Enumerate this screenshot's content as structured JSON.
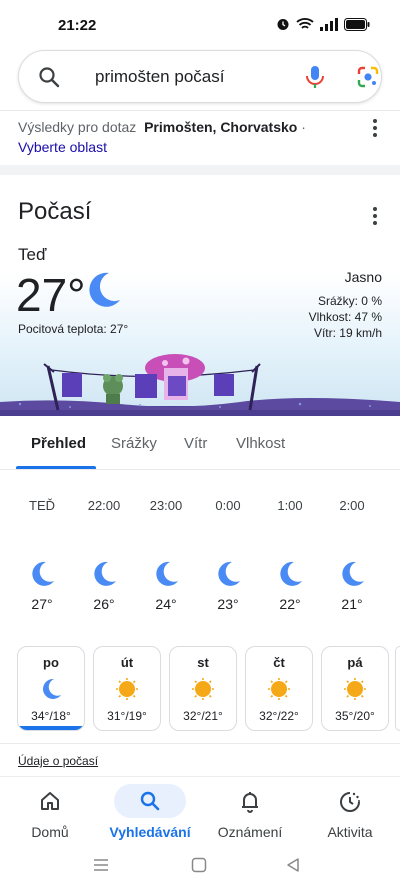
{
  "status": {
    "time": "21:22"
  },
  "search": {
    "query": "primošten počasí"
  },
  "results": {
    "prefix": "Výsledky pro dotaz",
    "place": "Primošten, Chorvatsko",
    "separator": "·",
    "choose_area": "Vyberte oblast"
  },
  "weather": {
    "title": "Počasí",
    "now_label": "Teď",
    "temperature": "27°",
    "feels_like": "Pocitová teplota: 27°",
    "condition": "Jasno",
    "precipitation": "Srážky: 0 %",
    "humidity": "Vlhkost: 47 %",
    "wind": "Vítr: 19 km/h",
    "tabs": [
      "Přehled",
      "Srážky",
      "Vítr",
      "Vlhkost"
    ],
    "hourly": [
      {
        "time": "TEĎ",
        "temp": "27°",
        "icon": "moon-icon"
      },
      {
        "time": "22:00",
        "temp": "26°",
        "icon": "moon-icon"
      },
      {
        "time": "23:00",
        "temp": "24°",
        "icon": "moon-icon"
      },
      {
        "time": "0:00",
        "temp": "23°",
        "icon": "moon-icon"
      },
      {
        "time": "1:00",
        "temp": "22°",
        "icon": "moon-icon"
      },
      {
        "time": "2:00",
        "temp": "21°",
        "icon": "moon-icon"
      }
    ],
    "daily": [
      {
        "day": "po",
        "temps": "34°/18°",
        "icon": "moon-icon",
        "selected": true
      },
      {
        "day": "út",
        "temps": "31°/19°",
        "icon": "sun-icon"
      },
      {
        "day": "st",
        "temps": "32°/21°",
        "icon": "sun-icon"
      },
      {
        "day": "čt",
        "temps": "32°/22°",
        "icon": "sun-icon"
      },
      {
        "day": "pá",
        "temps": "35°/20°",
        "icon": "sun-icon"
      }
    ],
    "data_link": "Údaje o počasí"
  },
  "nav": {
    "home": "Domů",
    "search": "Vyhledávání",
    "notifications": "Oznámení",
    "activity": "Aktivita"
  },
  "colors": {
    "accent": "#1a73e8",
    "moon": "#4a8af4",
    "sun": "#f6a918",
    "scene_ground": "#5b4aa0"
  }
}
